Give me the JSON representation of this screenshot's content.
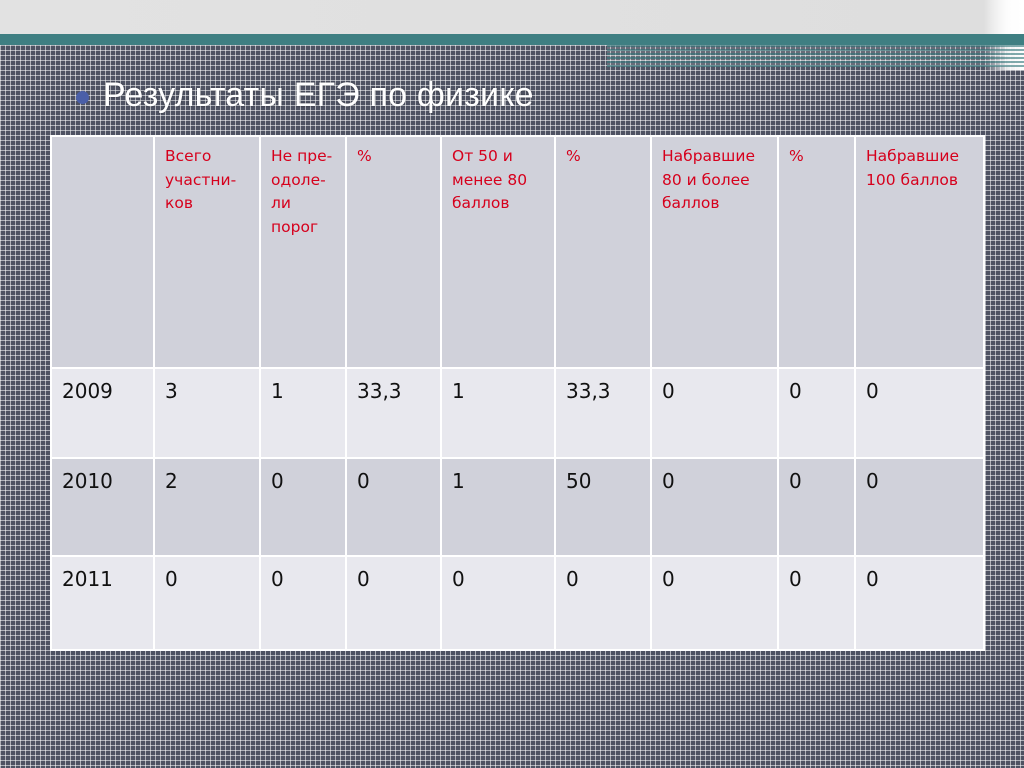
{
  "slide": {
    "title": "Результаты  ЕГЭ по физике"
  },
  "table": {
    "headers": [
      "",
      "Всего участни-ков",
      "Не пре-одоле-ли порог",
      "%",
      "От 50 и менее 80 баллов",
      "%",
      "Набравшие 80 и более баллов",
      "%",
      "Набравшие 100 баллов"
    ],
    "rows": [
      [
        "2009",
        "3",
        "1",
        "33,3",
        "1",
        "33,3",
        "0",
        "0",
        "0"
      ],
      [
        "2010",
        "2",
        "0",
        "0",
        "1",
        "50",
        "0",
        "0",
        "0"
      ],
      [
        "2011",
        "0",
        "0",
        "0",
        "0",
        "0",
        "0",
        "0",
        "0"
      ]
    ]
  },
  "colors": {
    "background": "#4e5262",
    "accent_teal": "#3f7f82",
    "header_text": "#d6001c",
    "bullet": "#4a5fa8"
  }
}
